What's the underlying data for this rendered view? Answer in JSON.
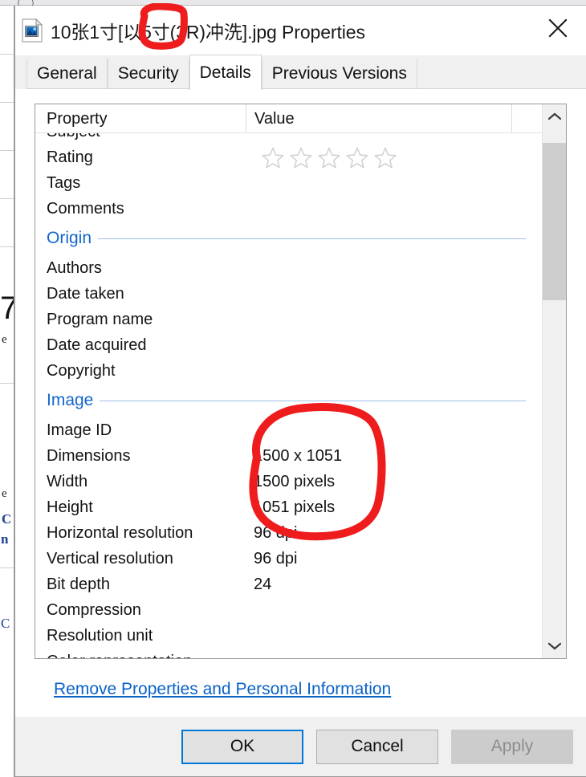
{
  "window": {
    "title": "10张1寸[以5寸(3R)冲洗].jpg Properties",
    "icon": "image-file-icon",
    "close_label": "✕"
  },
  "tabs": [
    {
      "label": "General",
      "active": false
    },
    {
      "label": "Security",
      "active": false
    },
    {
      "label": "Details",
      "active": true
    },
    {
      "label": "Previous Versions",
      "active": false
    }
  ],
  "details": {
    "columns": {
      "property": "Property",
      "value": "Value"
    },
    "rows": [
      {
        "kind": "row",
        "name": "Subject",
        "value": "",
        "clipped": "top"
      },
      {
        "kind": "row",
        "name": "Rating",
        "value": "",
        "stars": 0
      },
      {
        "kind": "row",
        "name": "Tags",
        "value": ""
      },
      {
        "kind": "row",
        "name": "Comments",
        "value": ""
      },
      {
        "kind": "section",
        "name": "Origin"
      },
      {
        "kind": "row",
        "name": "Authors",
        "value": ""
      },
      {
        "kind": "row",
        "name": "Date taken",
        "value": ""
      },
      {
        "kind": "row",
        "name": "Program name",
        "value": ""
      },
      {
        "kind": "row",
        "name": "Date acquired",
        "value": ""
      },
      {
        "kind": "row",
        "name": "Copyright",
        "value": ""
      },
      {
        "kind": "section",
        "name": "Image"
      },
      {
        "kind": "row",
        "name": "Image ID",
        "value": ""
      },
      {
        "kind": "row",
        "name": "Dimensions",
        "value": "1500 x 1051"
      },
      {
        "kind": "row",
        "name": "Width",
        "value": "1500 pixels"
      },
      {
        "kind": "row",
        "name": "Height",
        "value": "1051 pixels"
      },
      {
        "kind": "row",
        "name": "Horizontal resolution",
        "value": "96 dpi"
      },
      {
        "kind": "row",
        "name": "Vertical resolution",
        "value": "96 dpi"
      },
      {
        "kind": "row",
        "name": "Bit depth",
        "value": "24"
      },
      {
        "kind": "row",
        "name": "Compression",
        "value": ""
      },
      {
        "kind": "row",
        "name": "Resolution unit",
        "value": ""
      },
      {
        "kind": "row",
        "name": "Color representation",
        "value": "",
        "clipped": "bottom"
      }
    ],
    "rating_stars_total": 5,
    "rating_stars_filled": 0
  },
  "scrollbar": {
    "up_arrow": "chevron-up-icon",
    "down_arrow": "chevron-down-icon"
  },
  "links": {
    "remove_properties": "Remove Properties and Personal Information"
  },
  "buttons": {
    "ok": "OK",
    "cancel": "Cancel",
    "apply": "Apply"
  },
  "annotations": {
    "ink_color": "#ee1c1c",
    "circle_title_target": "5寸",
    "circle_values_target": "1500 x 1051 / 1500 pixels / 1051 pixels"
  },
  "background": {
    "top_strip_text": "…（…）",
    "left_fragments": [
      "7",
      "e",
      "e",
      "C",
      "n",
      "C"
    ]
  },
  "colors": {
    "accent_blue": "#0078d7",
    "link_blue": "#0a62c7",
    "section_blue": "#1366cc",
    "ink_red": "#ee1c1c",
    "dialog_bg": "#f0f0f0"
  }
}
